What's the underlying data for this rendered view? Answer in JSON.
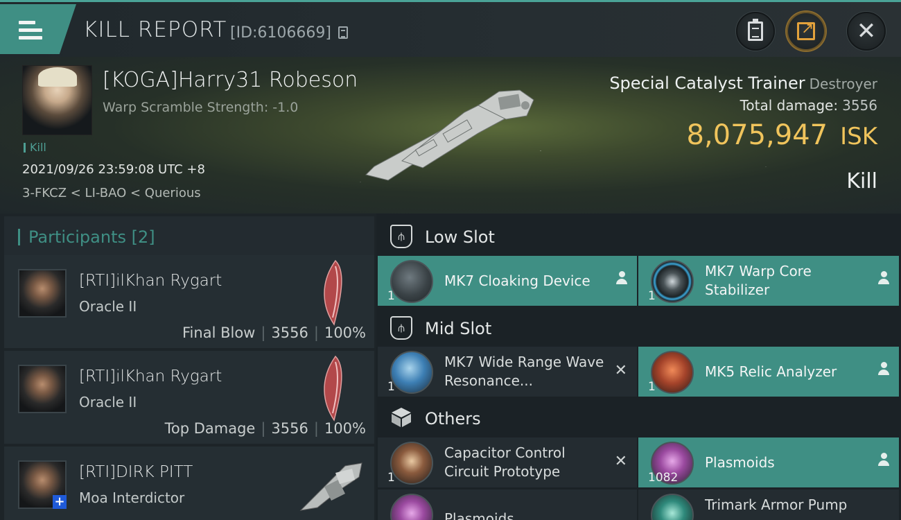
{
  "header": {
    "title": "KILL REPORT",
    "report_id": "[ID:6106669]"
  },
  "victim": {
    "name": "[KOGA]Harry31 Robeson",
    "warp_scramble": "Warp Scramble Strength: -1.0",
    "tag": "Kill",
    "timestamp": "2021/09/26 23:59:08 UTC +8",
    "location": "3-FKCZ < LI-BAO < Querious",
    "ship_name": "Special Catalyst Trainer",
    "ship_class": "Destroyer",
    "total_damage_label": "Total damage:",
    "total_damage": "3556",
    "isk_value": "8,075,947",
    "isk_unit": "ISK",
    "result": "Kill"
  },
  "participants": {
    "title": "Participants [2]",
    "rows": [
      {
        "name": "[RTI]ilKhan Rygart",
        "ship": "Oracle II",
        "role": "Final Blow",
        "damage": "3556",
        "percent": "100%"
      },
      {
        "name": "[RTI]ilKhan Rygart",
        "ship": "Oracle II",
        "role": "Top Damage",
        "damage": "3556",
        "percent": "100%"
      },
      {
        "name": "[RTI]DIRK PITT",
        "ship": "Moa Interdictor"
      }
    ]
  },
  "slots": {
    "low": {
      "label": "Low Slot",
      "items": [
        {
          "name": "MK7 Cloaking Device",
          "qty": "1",
          "status": "dropped"
        },
        {
          "name": "MK7 Warp Core Stabilizer",
          "qty": "1",
          "status": "dropped"
        }
      ]
    },
    "mid": {
      "label": "Mid Slot",
      "items": [
        {
          "name": "MK7 Wide Range Wave Resonance...",
          "qty": "1",
          "status": "destroyed"
        },
        {
          "name": "MK5 Relic Analyzer",
          "qty": "1",
          "status": "dropped"
        }
      ]
    },
    "others": {
      "label": "Others",
      "items": [
        {
          "name": "Capacitor Control Circuit Prototype",
          "qty": "1",
          "status": "destroyed"
        },
        {
          "name": "Plasmoids",
          "qty": "1082",
          "status": "dropped"
        },
        {
          "name": "Plasmoids",
          "qty": ""
        },
        {
          "name": "Trimark Armor Pump",
          "qty": ""
        }
      ]
    }
  },
  "colors": {
    "accent_teal": "#3f8f84",
    "isk_gold": "#f0c45c"
  }
}
